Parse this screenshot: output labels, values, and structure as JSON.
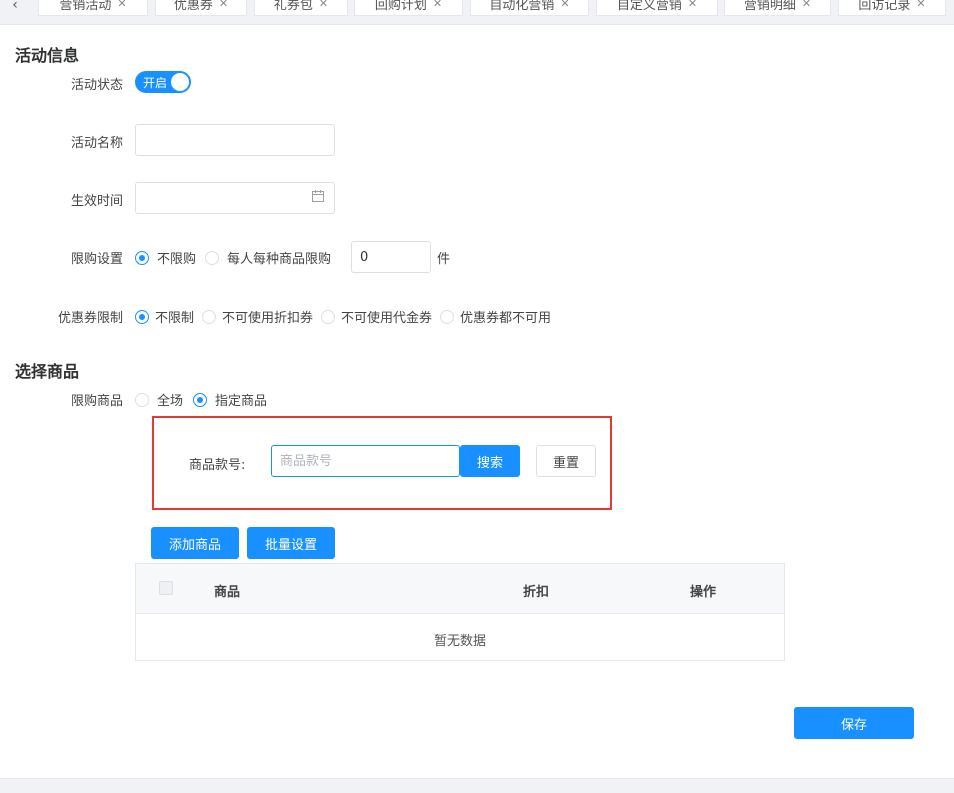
{
  "tabs": [
    {
      "label": "营销活动"
    },
    {
      "label": "优惠券"
    },
    {
      "label": "礼券包"
    },
    {
      "label": "回购计划"
    },
    {
      "label": "自动化营销"
    },
    {
      "label": "自定义营销"
    },
    {
      "label": "营销明细"
    },
    {
      "label": "回访记录"
    }
  ],
  "icons": {
    "back": "chevron-left-icon",
    "close": "close-icon",
    "calendar": "calendar-icon"
  },
  "activity_info": {
    "title": "活动信息",
    "status_label": "活动状态",
    "switch_text": "开启",
    "name_label": "活动名称",
    "name_value": "",
    "time_label": "生效时间",
    "time_value": "",
    "limit_label": "限购设置",
    "limit_options": [
      "不限购",
      "每人每种商品限购"
    ],
    "limit_selected": "不限购",
    "limit_qty": "0",
    "limit_unit": "件",
    "coupon_label": "优惠券限制",
    "coupon_options": [
      "不限制",
      "不可使用折扣券",
      "不可使用代金券",
      "优惠券都不可用"
    ],
    "coupon_selected": "不限制"
  },
  "select_goods": {
    "title": "选择商品",
    "goods_label": "限购商品",
    "goods_options": [
      "全场",
      "指定商品"
    ],
    "goods_selected": "指定商品",
    "search_label": "商品款号:",
    "search_placeholder": "商品款号",
    "search_button": "搜索",
    "reset_button": "重置",
    "add_button": "添加商品",
    "batch_button": "批量设置",
    "table": {
      "columns": [
        "商品",
        "折扣",
        "操作"
      ],
      "empty_text": "暂无数据"
    }
  },
  "save_button": "保存",
  "colors": {
    "primary": "#1890ff",
    "highlight_border": "#e53935"
  }
}
